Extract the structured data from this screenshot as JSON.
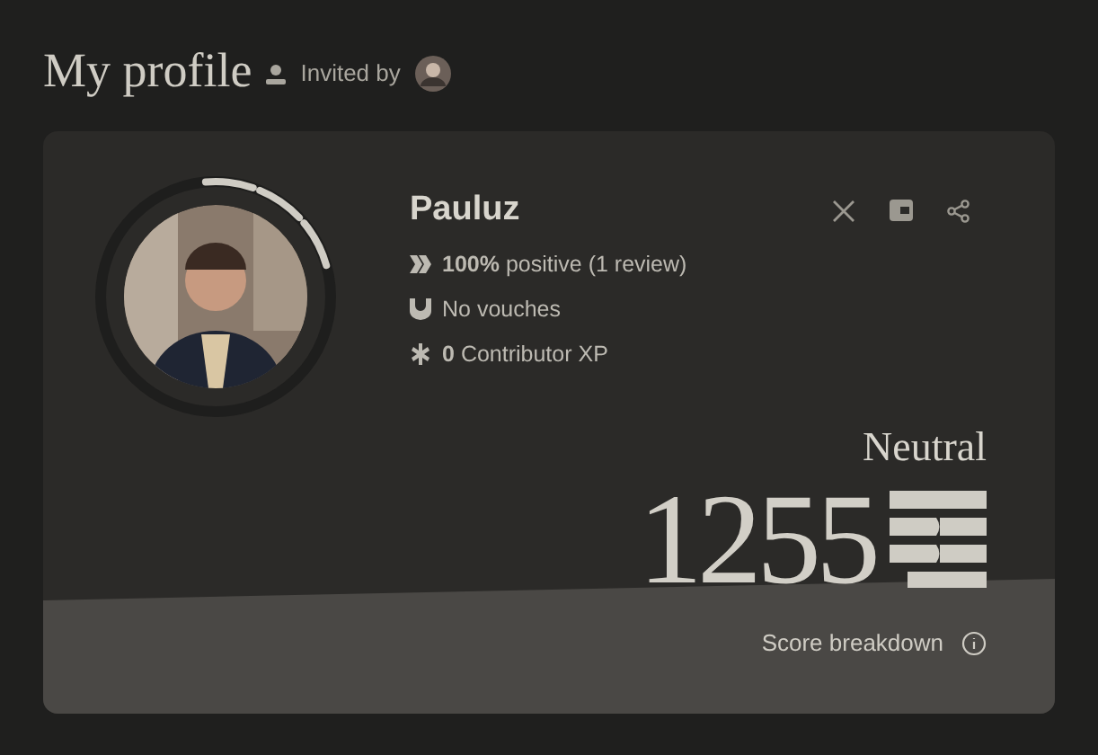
{
  "header": {
    "title": "My profile",
    "invited_label": "Invited by"
  },
  "profile": {
    "name": "Pauluz",
    "score_ring": {
      "level": 0.23
    },
    "stats": [
      {
        "kind": "reviews",
        "bold": "100%",
        "text": "positive (1 review)"
      },
      {
        "kind": "vouches",
        "text": "No vouches"
      },
      {
        "kind": "xp",
        "bold": "0",
        "text": "Contributor XP"
      }
    ],
    "actions": [
      {
        "kind": "x"
      },
      {
        "kind": "wallet"
      },
      {
        "kind": "share"
      }
    ]
  },
  "score": {
    "level_label": "Neutral",
    "value": "1255",
    "breakdown": "Score breakdown"
  }
}
